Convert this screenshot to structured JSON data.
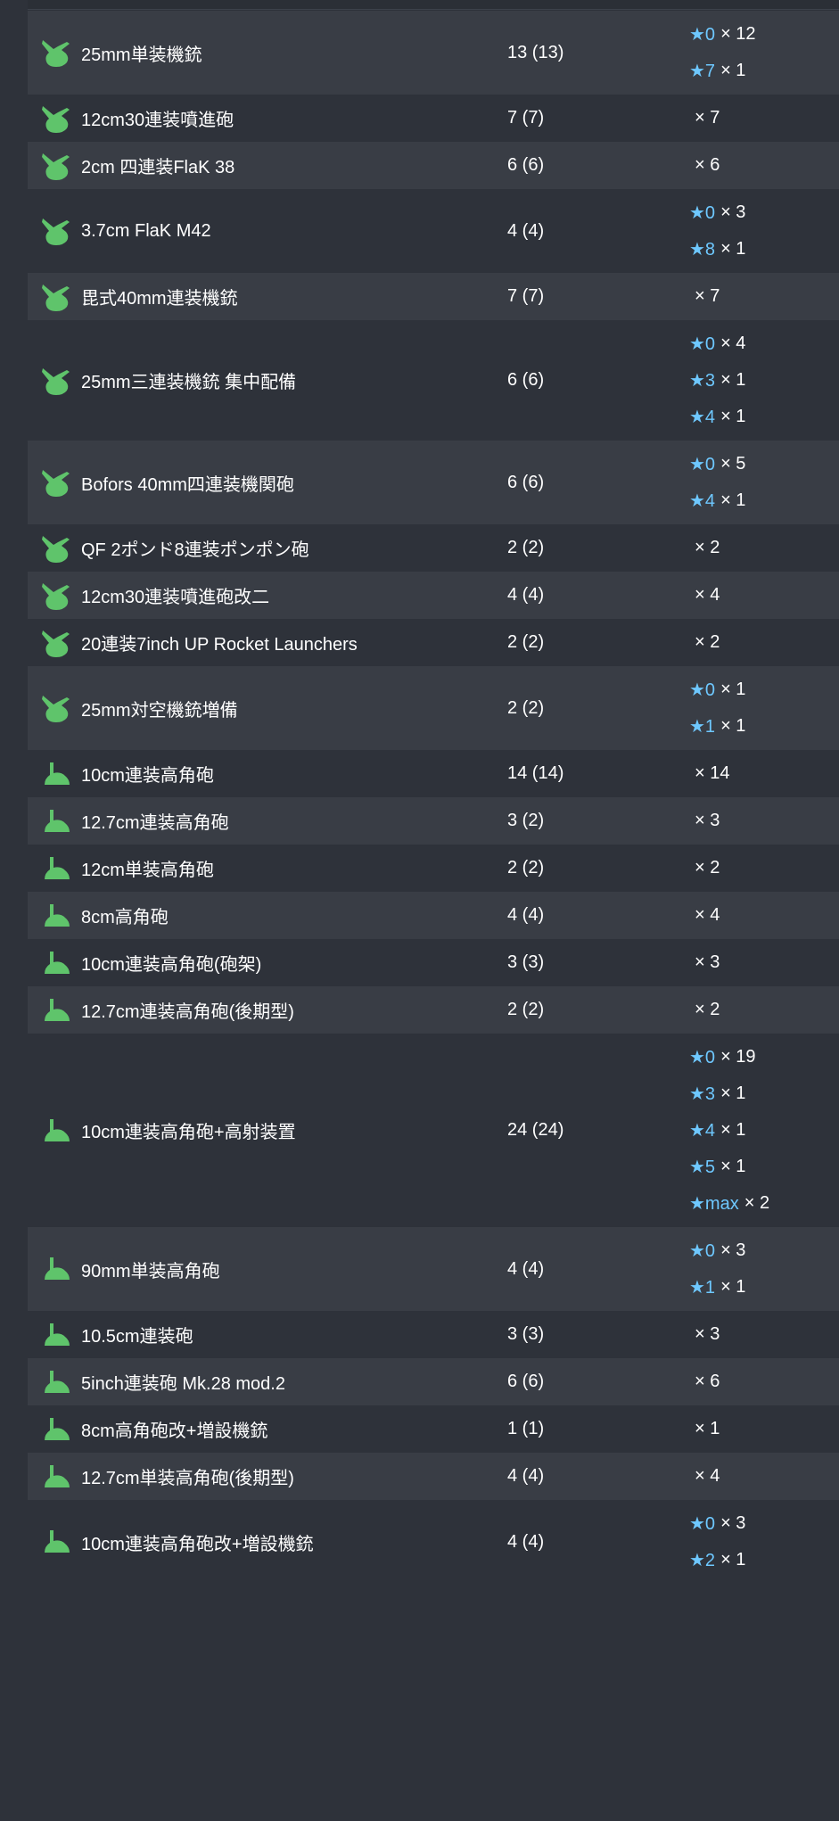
{
  "colors": {
    "background": "#2e323a",
    "row_alt": "#393d45",
    "star": "#6ec8ff",
    "icon_green": "#5fc46b"
  },
  "rows": [
    {
      "icon": "aa-machine-gun-icon",
      "name": "25mm単装機銃",
      "count": "13 (13)",
      "stars": [
        {
          "star": "★0",
          "mult": "× 12"
        },
        {
          "star": "★7",
          "mult": "× 1"
        }
      ]
    },
    {
      "icon": "aa-machine-gun-icon",
      "name": "12cm30連装噴進砲",
      "count": "7 (7)",
      "stars": [
        {
          "star": "",
          "mult": "× 7"
        }
      ]
    },
    {
      "icon": "aa-machine-gun-icon",
      "name": "2cm 四連装FlaK 38",
      "count": "6 (6)",
      "stars": [
        {
          "star": "",
          "mult": "× 6"
        }
      ]
    },
    {
      "icon": "aa-machine-gun-icon",
      "name": "3.7cm FlaK M42",
      "count": "4 (4)",
      "stars": [
        {
          "star": "★0",
          "mult": "× 3"
        },
        {
          "star": "★8",
          "mult": "× 1"
        }
      ]
    },
    {
      "icon": "aa-machine-gun-icon",
      "name": "毘式40mm連装機銃",
      "count": "7 (7)",
      "stars": [
        {
          "star": "",
          "mult": "× 7"
        }
      ]
    },
    {
      "icon": "aa-machine-gun-icon",
      "name": "25mm三連装機銃 集中配備",
      "count": "6 (6)",
      "stars": [
        {
          "star": "★0",
          "mult": "× 4"
        },
        {
          "star": "★3",
          "mult": "× 1"
        },
        {
          "star": "★4",
          "mult": "× 1"
        }
      ]
    },
    {
      "icon": "aa-machine-gun-icon",
      "name": "Bofors 40mm四連装機関砲",
      "count": "6 (6)",
      "stars": [
        {
          "star": "★0",
          "mult": "× 5"
        },
        {
          "star": "★4",
          "mult": "× 1"
        }
      ]
    },
    {
      "icon": "aa-machine-gun-icon",
      "name": "QF 2ポンド8連装ポンポン砲",
      "count": "2 (2)",
      "stars": [
        {
          "star": "",
          "mult": "× 2"
        }
      ]
    },
    {
      "icon": "aa-machine-gun-icon",
      "name": "12cm30連装噴進砲改二",
      "count": "4 (4)",
      "stars": [
        {
          "star": "",
          "mult": "× 4"
        }
      ]
    },
    {
      "icon": "aa-machine-gun-icon",
      "name": "20連装7inch UP Rocket Launchers",
      "count": "2 (2)",
      "stars": [
        {
          "star": "",
          "mult": "× 2"
        }
      ]
    },
    {
      "icon": "aa-machine-gun-icon",
      "name": "25mm対空機銃増備",
      "count": "2 (2)",
      "stars": [
        {
          "star": "★0",
          "mult": "× 1"
        },
        {
          "star": "★1",
          "mult": "× 1"
        }
      ]
    },
    {
      "icon": "high-angle-gun-icon",
      "name": "10cm連装高角砲",
      "count": "14 (14)",
      "stars": [
        {
          "star": "",
          "mult": "× 14"
        }
      ]
    },
    {
      "icon": "high-angle-gun-icon",
      "name": "12.7cm連装高角砲",
      "count": "3 (2)",
      "stars": [
        {
          "star": "",
          "mult": "× 3"
        }
      ]
    },
    {
      "icon": "high-angle-gun-icon",
      "name": "12cm単装高角砲",
      "count": "2 (2)",
      "stars": [
        {
          "star": "",
          "mult": "× 2"
        }
      ]
    },
    {
      "icon": "high-angle-gun-icon",
      "name": "8cm高角砲",
      "count": "4 (4)",
      "stars": [
        {
          "star": "",
          "mult": "× 4"
        }
      ]
    },
    {
      "icon": "high-angle-gun-icon",
      "name": "10cm連装高角砲(砲架)",
      "count": "3 (3)",
      "stars": [
        {
          "star": "",
          "mult": "× 3"
        }
      ]
    },
    {
      "icon": "high-angle-gun-icon",
      "name": "12.7cm連装高角砲(後期型)",
      "count": "2 (2)",
      "stars": [
        {
          "star": "",
          "mult": "× 2"
        }
      ]
    },
    {
      "icon": "high-angle-gun-icon",
      "name": "10cm連装高角砲+高射装置",
      "count": "24 (24)",
      "stars": [
        {
          "star": "★0",
          "mult": "× 19"
        },
        {
          "star": "★3",
          "mult": "× 1"
        },
        {
          "star": "★4",
          "mult": "× 1"
        },
        {
          "star": "★5",
          "mult": "× 1"
        },
        {
          "star": "★max",
          "mult": "× 2"
        }
      ]
    },
    {
      "icon": "high-angle-gun-icon",
      "name": "90mm単装高角砲",
      "count": "4 (4)",
      "stars": [
        {
          "star": "★0",
          "mult": "× 3"
        },
        {
          "star": "★1",
          "mult": "× 1"
        }
      ]
    },
    {
      "icon": "high-angle-gun-icon",
      "name": "10.5cm連装砲",
      "count": "3 (3)",
      "stars": [
        {
          "star": "",
          "mult": "× 3"
        }
      ]
    },
    {
      "icon": "high-angle-gun-icon",
      "name": "5inch連装砲 Mk.28 mod.2",
      "count": "6 (6)",
      "stars": [
        {
          "star": "",
          "mult": "× 6"
        }
      ]
    },
    {
      "icon": "high-angle-gun-icon",
      "name": "8cm高角砲改+増設機銃",
      "count": "1 (1)",
      "stars": [
        {
          "star": "",
          "mult": "× 1"
        }
      ]
    },
    {
      "icon": "high-angle-gun-icon",
      "name": "12.7cm単装高角砲(後期型)",
      "count": "4 (4)",
      "stars": [
        {
          "star": "",
          "mult": "× 4"
        }
      ]
    },
    {
      "icon": "high-angle-gun-icon",
      "name": "10cm連装高角砲改+増設機銃",
      "count": "4 (4)",
      "stars": [
        {
          "star": "★0",
          "mult": "× 3"
        },
        {
          "star": "★2",
          "mult": "× 1"
        }
      ]
    }
  ]
}
